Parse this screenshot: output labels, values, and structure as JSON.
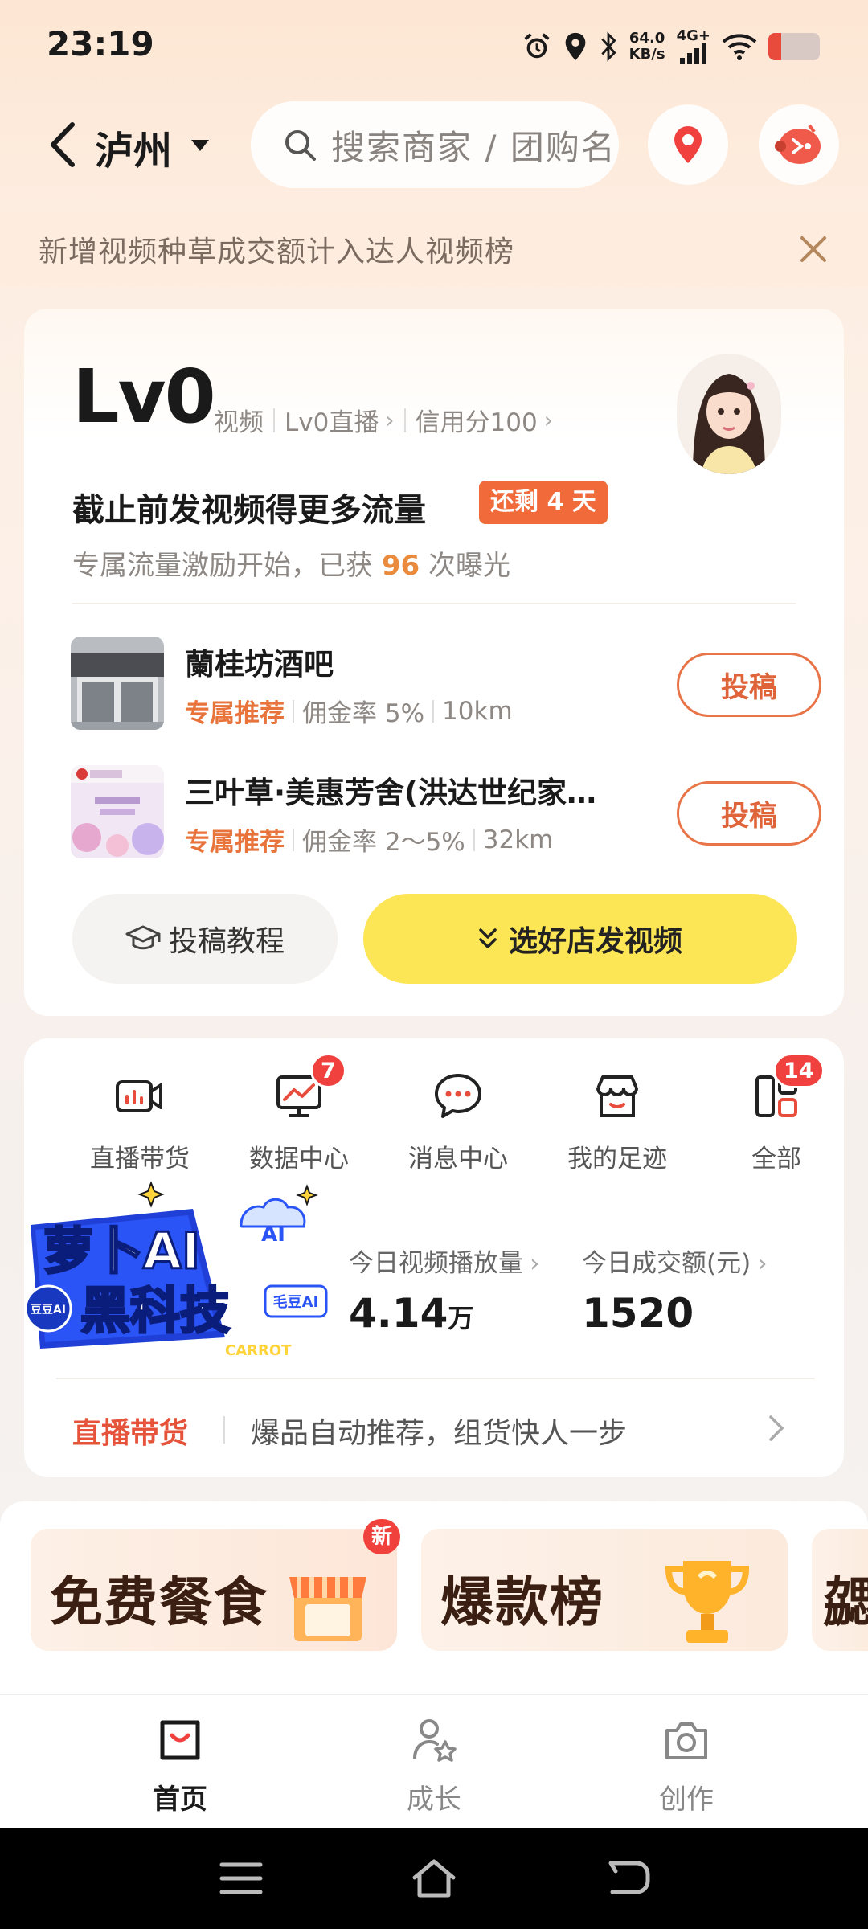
{
  "status_bar": {
    "time": "23:19",
    "net_speed_value": "64.0",
    "net_speed_unit": "KB/s",
    "net_type": "4G+",
    "battery_level": 0.25
  },
  "header": {
    "city": "泸州",
    "search_placeholder": "搜索商家 / 团购名",
    "icons": [
      "back-arrow-icon",
      "caret-down-icon",
      "search-icon",
      "location-pin-icon",
      "ai-bot-icon"
    ]
  },
  "notice": {
    "text": "新增视频种草成交额计入达人视频榜"
  },
  "level_card": {
    "level": "Lv0",
    "meta": [
      "视频",
      "Lv0直播",
      "信用分100"
    ],
    "promo_title": "截止前发视频得更多流量",
    "days_left": "还剩 4 天",
    "sub_prefix": "专属流量激励开始，已获",
    "sub_count": "96",
    "sub_suffix": "次曝光",
    "shops": [
      {
        "name": "蘭桂坊酒吧",
        "tag": "专属推荐",
        "commission": "佣金率 5%",
        "distance": "10km",
        "button": "投稿"
      },
      {
        "name": "三叶草·美惠芳舍(洪达世纪家…",
        "tag": "专属推荐",
        "commission": "佣金率 2～5%",
        "distance": "32km",
        "button": "投稿"
      }
    ],
    "tutorial_label": "投稿教程",
    "choose_label": "选好店发视频"
  },
  "tools_card": {
    "functions": [
      {
        "label": "直播带货",
        "icon": "live-stream-icon",
        "badge": ""
      },
      {
        "label": "数据中心",
        "icon": "data-chart-icon",
        "badge": "7"
      },
      {
        "label": "消息中心",
        "icon": "message-icon",
        "badge": ""
      },
      {
        "label": "我的足迹",
        "icon": "storefront-icon",
        "badge": ""
      },
      {
        "label": "全部",
        "icon": "all-apps-icon",
        "badge": "14"
      }
    ],
    "ai_banner": {
      "line1": "萝卜AI",
      "line2": "黑科技",
      "sub": "CARROT",
      "badge": "毛豆AI",
      "cloud": "AI",
      "disc": "豆豆AI"
    },
    "stats": [
      {
        "label": "今日视频播放量",
        "value": "4.14",
        "unit": "万"
      },
      {
        "label": "今日成交额(元)",
        "value": "1520",
        "unit": ""
      }
    ],
    "live_tag": "直播带货",
    "live_desc": "爆品自动推荐，组货快人一步"
  },
  "tiles": [
    {
      "text": "免费餐食",
      "new_badge": "新"
    },
    {
      "text": "爆款榜",
      "new_badge": ""
    },
    {
      "text": "勰",
      "new_badge": ""
    }
  ],
  "bottom_nav": [
    {
      "label": "首页",
      "icon": "shopping-bag-icon",
      "active": true
    },
    {
      "label": "成长",
      "icon": "user-star-icon",
      "active": false
    },
    {
      "label": "创作",
      "icon": "camera-icon",
      "active": false
    }
  ],
  "colors": {
    "accent_orange": "#e8743c",
    "badge_red": "#f0413f",
    "cta_yellow": "#fde655",
    "live_red": "#e6533b"
  }
}
